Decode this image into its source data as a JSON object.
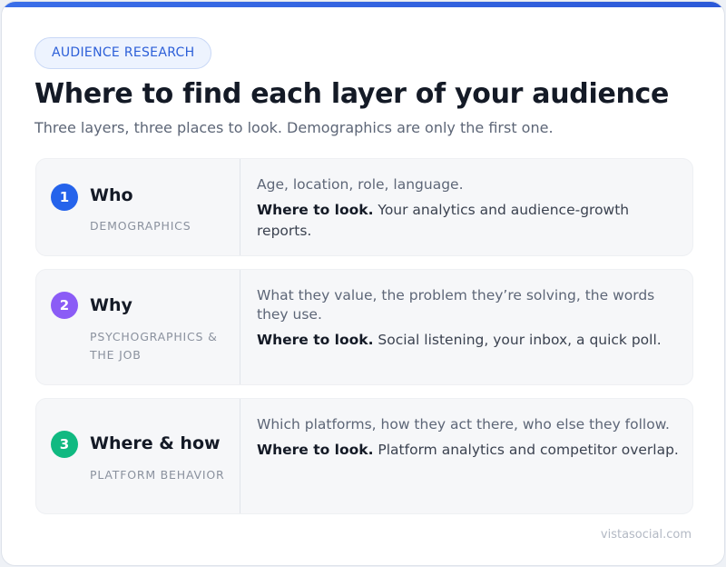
{
  "brand": {
    "accent": "#2c59d8"
  },
  "badge": "AUDIENCE RESEARCH",
  "title": "Where to find each layer of your audience",
  "subtitle": "Three layers, three places to look. Demographics are only the first one.",
  "look_label": "Where to look.",
  "layers": [
    {
      "number": "1",
      "color": "#2563eb",
      "title": "Who",
      "subtitle": "DEMOGRAPHICS",
      "description": "Age, location, role, language.",
      "where": "Your analytics and audience-growth reports."
    },
    {
      "number": "2",
      "color": "#8b5cf6",
      "title": "Why",
      "subtitle": "PSYCHOGRAPHICS & THE JOB",
      "description": "What they value, the problem they’re solving, the words they use.",
      "where": "Social listening, your inbox, a quick poll."
    },
    {
      "number": "3",
      "color": "#10b981",
      "title": "Where & how",
      "subtitle": "PLATFORM BEHAVIOR",
      "description": "Which platforms, how they act there, who else they follow.",
      "where": "Platform analytics and competitor overlap."
    }
  ],
  "footer": "vistasocial.com"
}
